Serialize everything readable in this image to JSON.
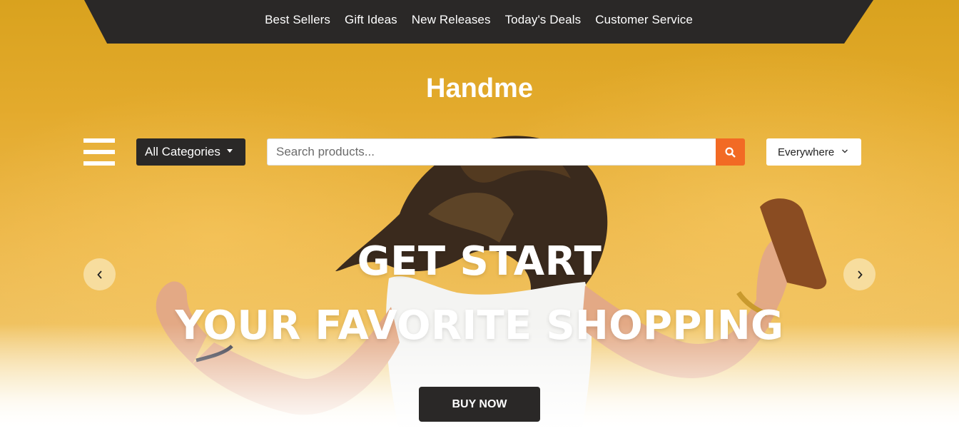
{
  "topnav": {
    "items": [
      {
        "label": "Best Sellers"
      },
      {
        "label": "Gift Ideas"
      },
      {
        "label": "New Releases"
      },
      {
        "label": "Today's Deals"
      },
      {
        "label": "Customer Service"
      }
    ]
  },
  "brand": {
    "name": "Handme"
  },
  "searchbar": {
    "categories_label": "All Categories",
    "search_placeholder": "Search products...",
    "location_label": "Everywhere"
  },
  "hero": {
    "headline_line1": "GET START",
    "headline_line2": "YOUR FAVORITE SHOPPING",
    "cta_label": "BUY NOW"
  },
  "icons": {
    "menu": "hamburger-menu-icon",
    "search": "search-icon",
    "dropdown": "chevron-down-icon",
    "prev": "chevron-left-icon",
    "next": "chevron-right-icon"
  },
  "colors": {
    "nav_dark": "#2a2827",
    "search_accent": "#f26a24",
    "hero_yellow": "#e6ae33"
  }
}
